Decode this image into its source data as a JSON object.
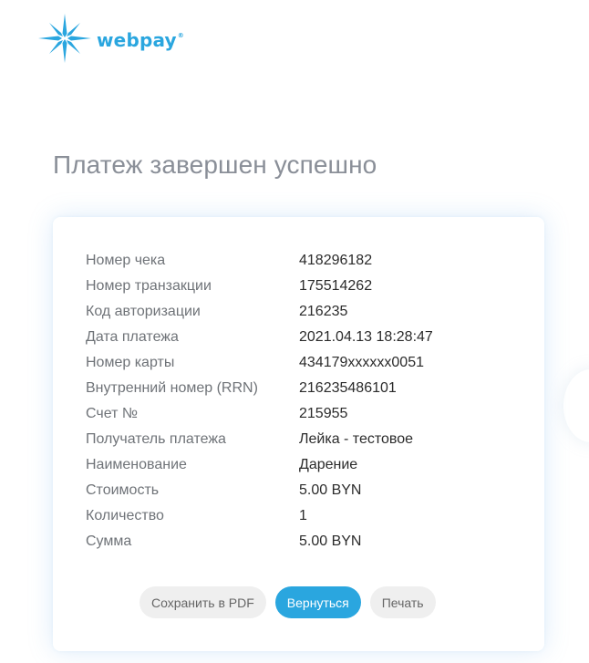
{
  "logo": {
    "brand": "webpay",
    "reg_mark": "®",
    "icon": "star-burst-icon"
  },
  "page": {
    "title": "Платеж завершен успешно"
  },
  "details": [
    {
      "label": "Номер чека",
      "value": "418296182"
    },
    {
      "label": "Номер транзакции",
      "value": "175514262"
    },
    {
      "label": "Код авторизации",
      "value": "216235"
    },
    {
      "label": "Дата платежа",
      "value": "2021.04.13 18:28:47"
    },
    {
      "label": "Номер карты",
      "value": "434179xxxxxx0051"
    },
    {
      "label": "Внутренний номер (RRN)",
      "value": "216235486101"
    },
    {
      "label": "Счет №",
      "value": "215955"
    },
    {
      "label": "Получатель платежа",
      "value": "Лейка - тестовое"
    },
    {
      "label": "Наименование",
      "value": "Дарение"
    },
    {
      "label": "Стоимость",
      "value": "5.00 BYN"
    },
    {
      "label": "Количество",
      "value": "1"
    },
    {
      "label": "Сумма",
      "value": "5.00 BYN"
    }
  ],
  "actions": {
    "save_pdf": "Сохранить в PDF",
    "back": "Вернуться",
    "print": "Печать"
  },
  "colors": {
    "brand_blue": "#2aa6df",
    "title_gray": "#8a8f98",
    "label_gray": "#6f7378",
    "value_dark": "#2b2b2b",
    "button_text_gray": "#666666"
  }
}
